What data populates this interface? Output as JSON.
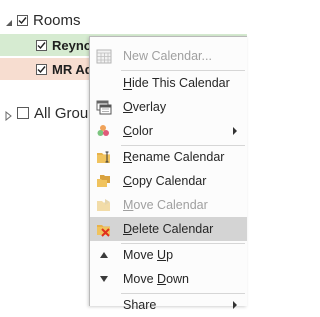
{
  "tree": {
    "rooms_group": {
      "label": "Rooms",
      "checked": true
    },
    "rooms_items": [
      {
        "label": "Reynolds Court Conf Hall",
        "checked": true,
        "color": "#d6ebd1"
      },
      {
        "label": "MR Ad",
        "checked": true,
        "color": "#f7ddd0"
      }
    ],
    "all_groups": {
      "label": "All Grou",
      "checked": false
    }
  },
  "menu": {
    "items": [
      {
        "id": "new-calendar",
        "label": "New Calendar...",
        "disabled": true,
        "icon": "calendar-grid-icon"
      },
      {
        "id": "hide-calendar",
        "label": "Hide This Calendar",
        "underline": "H"
      },
      {
        "id": "overlay",
        "label": "Overlay",
        "underline": "O",
        "icon": "overlay-icon"
      },
      {
        "id": "color",
        "label": "Color",
        "underline": "C",
        "icon": "color-palette-icon",
        "submenu": true
      },
      {
        "id": "rename-calendar",
        "label": "Rename Calendar",
        "underline": "R",
        "icon": "rename-folder-icon"
      },
      {
        "id": "copy-calendar",
        "label": "Copy Calendar",
        "underline": "C",
        "icon": "copy-folder-icon"
      },
      {
        "id": "move-calendar",
        "label": "Move Calendar",
        "disabled": true,
        "underline": "M",
        "icon": "move-folder-icon"
      },
      {
        "id": "delete-calendar",
        "label": "Delete Calendar",
        "underline": "D",
        "icon": "delete-calendar-icon",
        "selected": true
      },
      {
        "id": "move-up",
        "label": "Move Up",
        "underline": "U",
        "icon": "triangle-up-icon"
      },
      {
        "id": "move-down",
        "label": "Move Down",
        "underline": "D",
        "icon": "triangle-down-icon"
      },
      {
        "id": "share",
        "label": "Share",
        "submenu": true
      }
    ]
  },
  "colors": {
    "selected_highlight": "#d4d4d4",
    "disabled_text": "#a0a0a0",
    "delete_red": "#e0301e",
    "folder_yellow": "#e8b24a"
  }
}
